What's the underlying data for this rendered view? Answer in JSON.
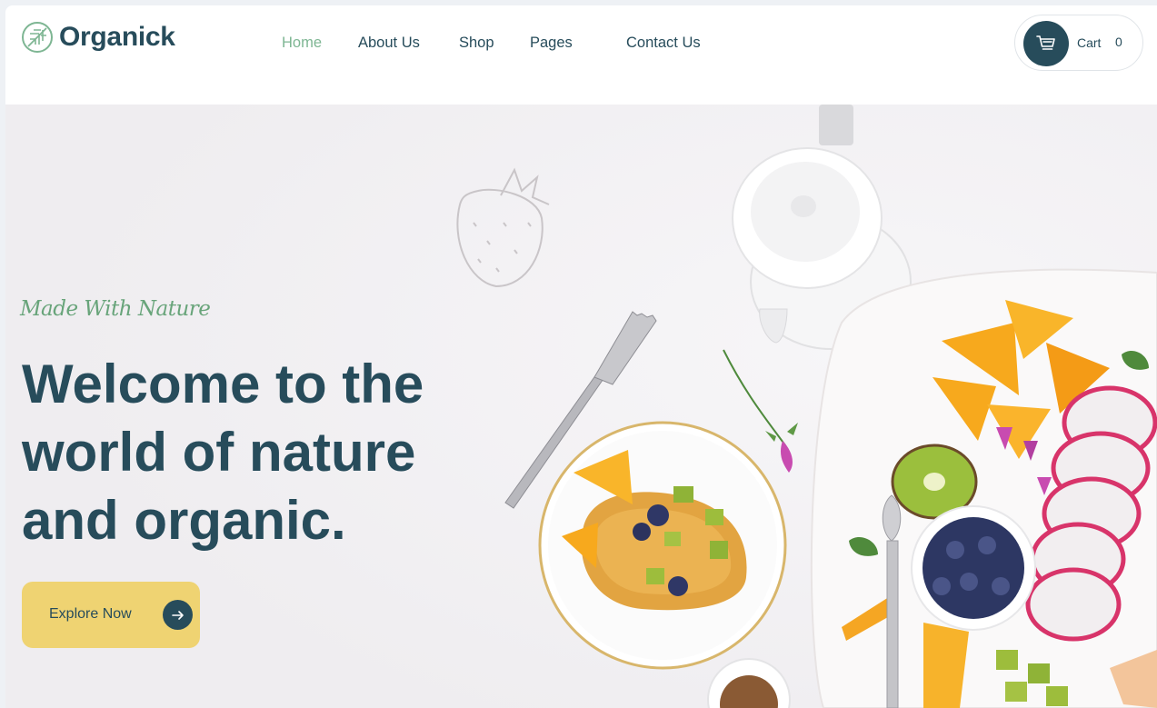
{
  "brand": {
    "name": "Organick",
    "accent": "#7eb693",
    "primary": "#274c5b",
    "button": "#efd372"
  },
  "nav": {
    "items": [
      {
        "label": "Home",
        "active": true
      },
      {
        "label": "About Us",
        "active": false
      },
      {
        "label": "Shop",
        "active": false
      },
      {
        "label": "Pages",
        "active": false
      },
      {
        "label": "Contact Us",
        "active": false
      }
    ]
  },
  "cart": {
    "label": "Cart",
    "count": "0",
    "icon": "cart-icon"
  },
  "hero": {
    "tagline": "Made With Nature",
    "headline": "Welcome to the world of nature and organic.",
    "cta_label": "Explore Now",
    "cta_icon": "arrow-right-icon"
  }
}
